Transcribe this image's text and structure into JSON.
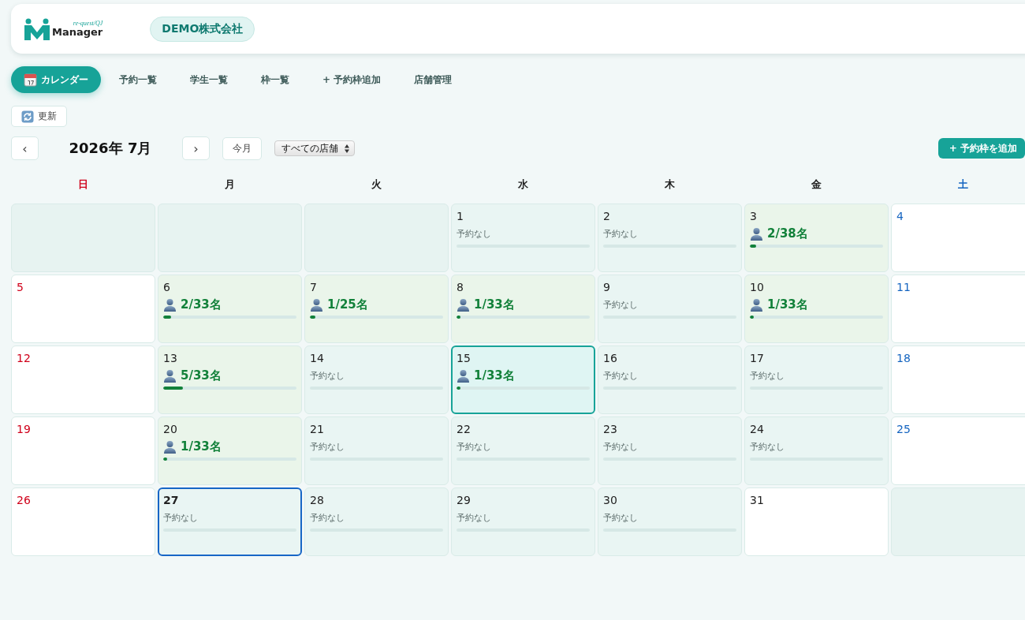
{
  "header": {
    "logo_tagline": "re-quest/QJ",
    "logo_name": "Manager",
    "company": "DEMO株式会社"
  },
  "tabs": [
    {
      "label": "カレンダー",
      "selected": true
    },
    {
      "label": "予約一覧",
      "selected": false
    },
    {
      "label": "学生一覧",
      "selected": false
    },
    {
      "label": "枠一覧",
      "selected": false
    },
    {
      "label": "+ 予約枠追加",
      "selected": false
    },
    {
      "label": "店舗管理",
      "selected": false
    }
  ],
  "refresh_button": "更新",
  "toolbar": {
    "prev": "‹",
    "month": "2026年 7月",
    "next": "›",
    "today": "今月",
    "store_select": "すべての店舗",
    "add_button": "+ 予約枠を追加"
  },
  "weekdays": [
    {
      "label": "日",
      "color": "#d0021b"
    },
    {
      "label": "月",
      "color": "#222222"
    },
    {
      "label": "火",
      "color": "#222222"
    },
    {
      "label": "水",
      "color": "#222222"
    },
    {
      "label": "木",
      "color": "#222222"
    },
    {
      "label": "金",
      "color": "#222222"
    },
    {
      "label": "土",
      "color": "#1565c0"
    }
  ],
  "days": [
    {
      "kind": "blank"
    },
    {
      "kind": "blank"
    },
    {
      "kind": "blank"
    },
    {
      "kind": "slots",
      "day": "1",
      "reservation": "予約なし",
      "booked": false,
      "selected": false,
      "today": false
    },
    {
      "kind": "slots",
      "day": "2",
      "reservation": "予約なし",
      "booked": false,
      "selected": false,
      "today": false
    },
    {
      "kind": "slots",
      "day": "3",
      "reservation": "2/38名",
      "booked": true,
      "level": 0.05,
      "selected": false,
      "today": false
    },
    {
      "kind": "closed",
      "day": "4"
    },
    {
      "kind": "closed",
      "day": "5"
    },
    {
      "kind": "slots",
      "day": "6",
      "reservation": "2/33名",
      "booked": true,
      "level": 0.06,
      "selected": false,
      "today": false
    },
    {
      "kind": "slots",
      "day": "7",
      "reservation": "1/25名",
      "booked": true,
      "level": 0.04,
      "selected": false,
      "today": false
    },
    {
      "kind": "slots",
      "day": "8",
      "reservation": "1/33名",
      "booked": true,
      "level": 0.03,
      "selected": false,
      "today": false
    },
    {
      "kind": "slots",
      "day": "9",
      "reservation": "予約なし",
      "booked": false,
      "selected": false,
      "today": false
    },
    {
      "kind": "slots",
      "day": "10",
      "reservation": "1/33名",
      "booked": true,
      "level": 0.03,
      "selected": false,
      "today": false
    },
    {
      "kind": "closed",
      "day": "11"
    },
    {
      "kind": "closed",
      "day": "12"
    },
    {
      "kind": "slots",
      "day": "13",
      "reservation": "5/33名",
      "booked": true,
      "level": 0.15,
      "selected": false,
      "today": false
    },
    {
      "kind": "slots",
      "day": "14",
      "reservation": "予約なし",
      "booked": false,
      "selected": false,
      "today": false
    },
    {
      "kind": "slots",
      "day": "15",
      "reservation": "1/33名",
      "booked": true,
      "level": 0.03,
      "selected": true,
      "today": false
    },
    {
      "kind": "slots",
      "day": "16",
      "reservation": "予約なし",
      "booked": false,
      "selected": false,
      "today": false
    },
    {
      "kind": "slots",
      "day": "17",
      "reservation": "予約なし",
      "booked": false,
      "selected": false,
      "today": false
    },
    {
      "kind": "closed",
      "day": "18"
    },
    {
      "kind": "closed",
      "day": "19"
    },
    {
      "kind": "slots",
      "day": "20",
      "reservation": "1/33名",
      "booked": true,
      "level": 0.03,
      "selected": false,
      "today": false
    },
    {
      "kind": "slots",
      "day": "21",
      "reservation": "予約なし",
      "booked": false,
      "selected": false,
      "today": false
    },
    {
      "kind": "slots",
      "day": "22",
      "reservation": "予約なし",
      "booked": false,
      "selected": false,
      "today": false
    },
    {
      "kind": "slots",
      "day": "23",
      "reservation": "予約なし",
      "booked": false,
      "selected": false,
      "today": false
    },
    {
      "kind": "slots",
      "day": "24",
      "reservation": "予約なし",
      "booked": false,
      "selected": false,
      "today": false
    },
    {
      "kind": "closed",
      "day": "25"
    },
    {
      "kind": "closed",
      "day": "26"
    },
    {
      "kind": "slots",
      "day": "27",
      "reservation": "予約なし",
      "booked": false,
      "selected": false,
      "today": true
    },
    {
      "kind": "slots",
      "day": "28",
      "reservation": "予約なし",
      "booked": false,
      "selected": false,
      "today": false
    },
    {
      "kind": "slots",
      "day": "29",
      "reservation": "予約なし",
      "booked": false,
      "selected": false,
      "today": false
    },
    {
      "kind": "slots",
      "day": "30",
      "reservation": "予約なし",
      "booked": false,
      "selected": false,
      "today": false
    },
    {
      "kind": "closed",
      "day": "31"
    },
    {
      "kind": "blank"
    }
  ]
}
